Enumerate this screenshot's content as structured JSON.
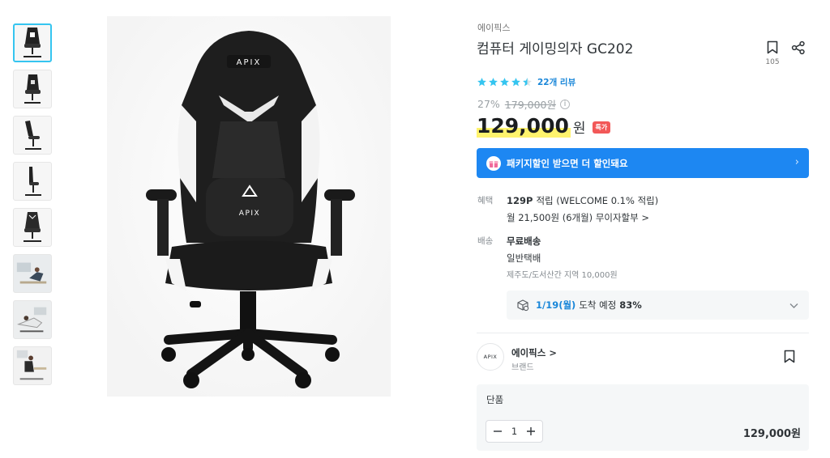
{
  "gallery": {
    "thumbnails": [
      {
        "name": "thumb-front-view",
        "selected": true
      },
      {
        "name": "thumb-angle-view",
        "selected": false
      },
      {
        "name": "thumb-side-reclined",
        "selected": false
      },
      {
        "name": "thumb-side-view",
        "selected": false
      },
      {
        "name": "thumb-back-view",
        "selected": false
      },
      {
        "name": "thumb-lifestyle-1",
        "selected": false
      },
      {
        "name": "thumb-lifestyle-2",
        "selected": false
      },
      {
        "name": "thumb-lifestyle-3",
        "selected": false
      }
    ],
    "main_image": {
      "brand_mark_top": "APIX",
      "brand_mark_center": "APIX"
    }
  },
  "product": {
    "brand": "에이픽스",
    "title": "컴퓨터 게이밍의자 GC202",
    "bookmark_count": "105",
    "rating": {
      "stars": 4.5,
      "review_text": "22개 리뷰"
    },
    "discount": "27%",
    "original_price": "179,000원",
    "price": "129,000",
    "currency": "원",
    "badge": "특가"
  },
  "package_banner": {
    "text": "패키지할인 받으면 더 할인돼요",
    "arrow": "›"
  },
  "benefit": {
    "label": "혜택",
    "points": "129P",
    "points_text": "적립 (WELCOME 0.1% 적립)",
    "installment": "월 21,500원 (6개월) 무이자할부 >"
  },
  "shipping": {
    "label": "배송",
    "type": "무료배송",
    "method": "일반택배",
    "extra": "제주도/도서산간 지역 10,000원",
    "delivery_date": "1/19(월)",
    "delivery_text": "도착 예정",
    "delivery_pct": "83%"
  },
  "store": {
    "logo_text": "APIX",
    "name": "에이픽스 >",
    "subtitle": "브랜드"
  },
  "option": {
    "name": "단품",
    "quantity": "1",
    "price": "129,000원"
  },
  "colors": {
    "accent": "#35c5f0",
    "banner": "#1d87f2",
    "star": "#35c5f0",
    "badge": "#f25858",
    "highlight": "#fff36d"
  }
}
